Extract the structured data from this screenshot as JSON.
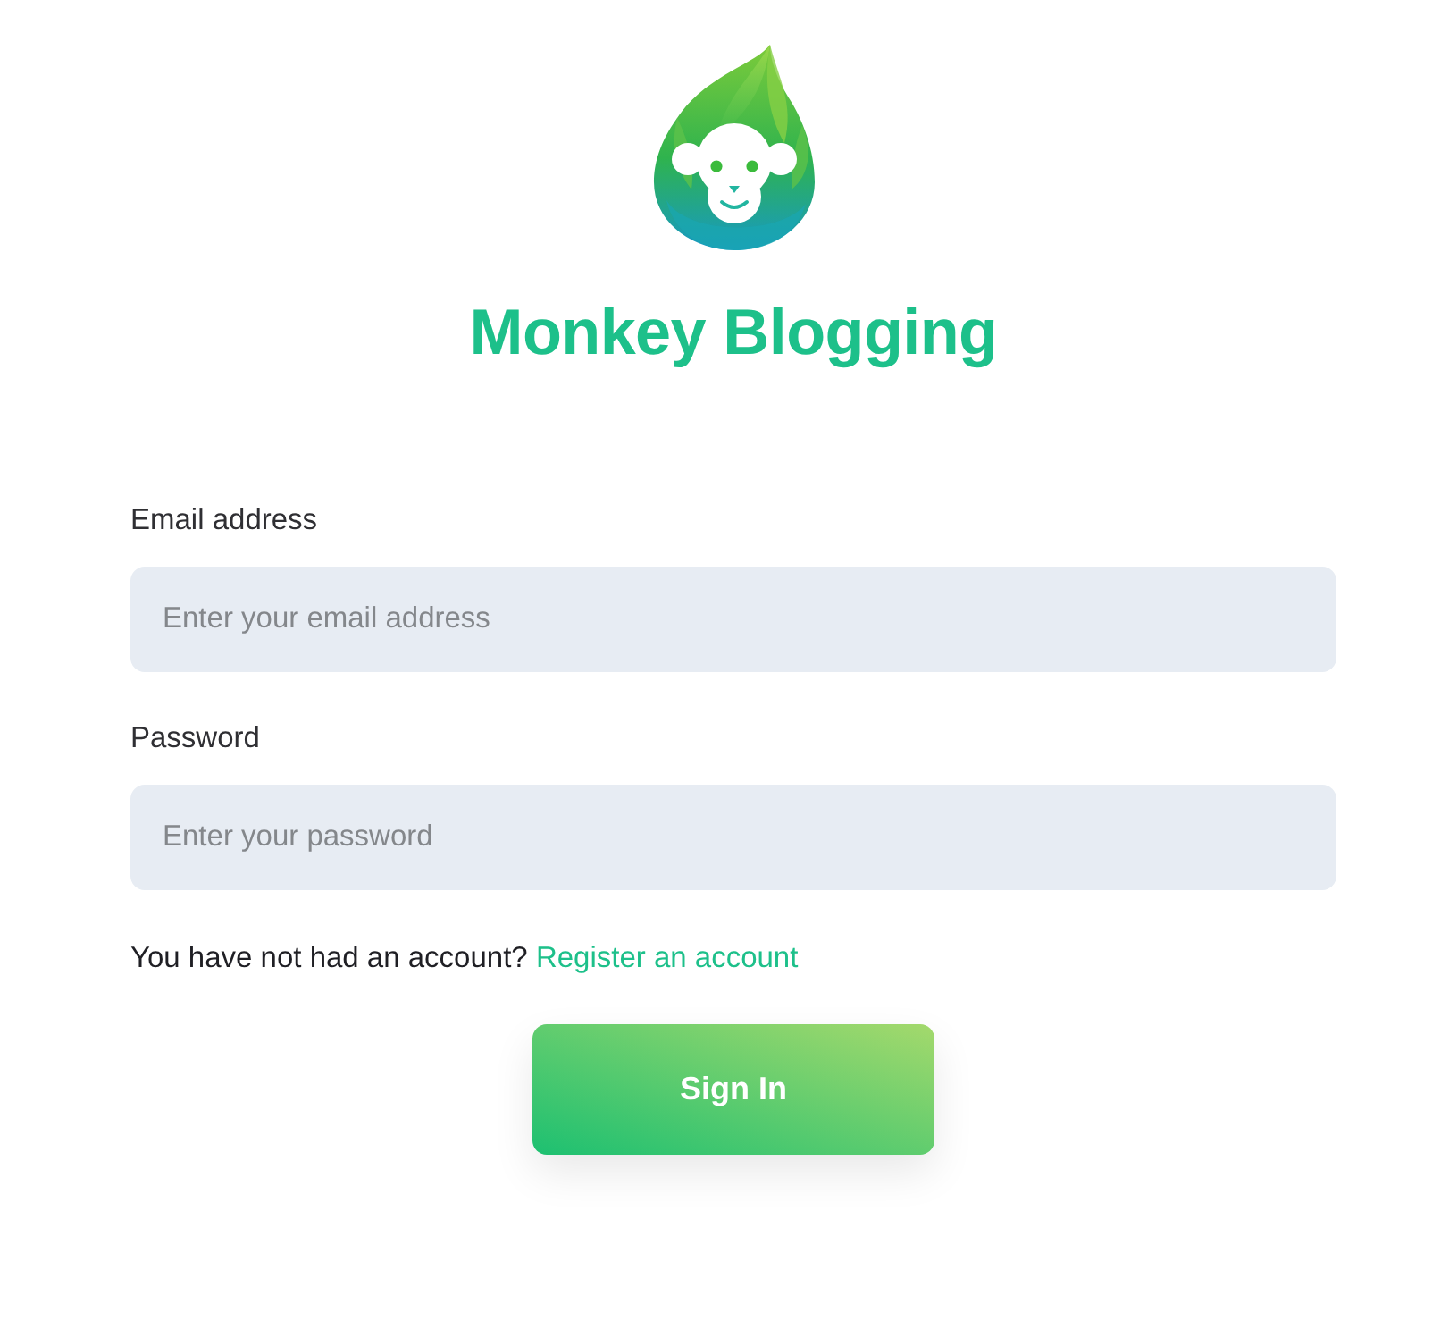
{
  "brand": {
    "title": "Monkey Blogging"
  },
  "fields": [
    {
      "label": "Email address",
      "placeholder": "Enter your email address"
    },
    {
      "label": "Password",
      "placeholder": "Enter your password"
    }
  ],
  "prompt": {
    "text": "You have not had an account?",
    "link": "Register an account"
  },
  "submit": {
    "label": "Sign In"
  }
}
